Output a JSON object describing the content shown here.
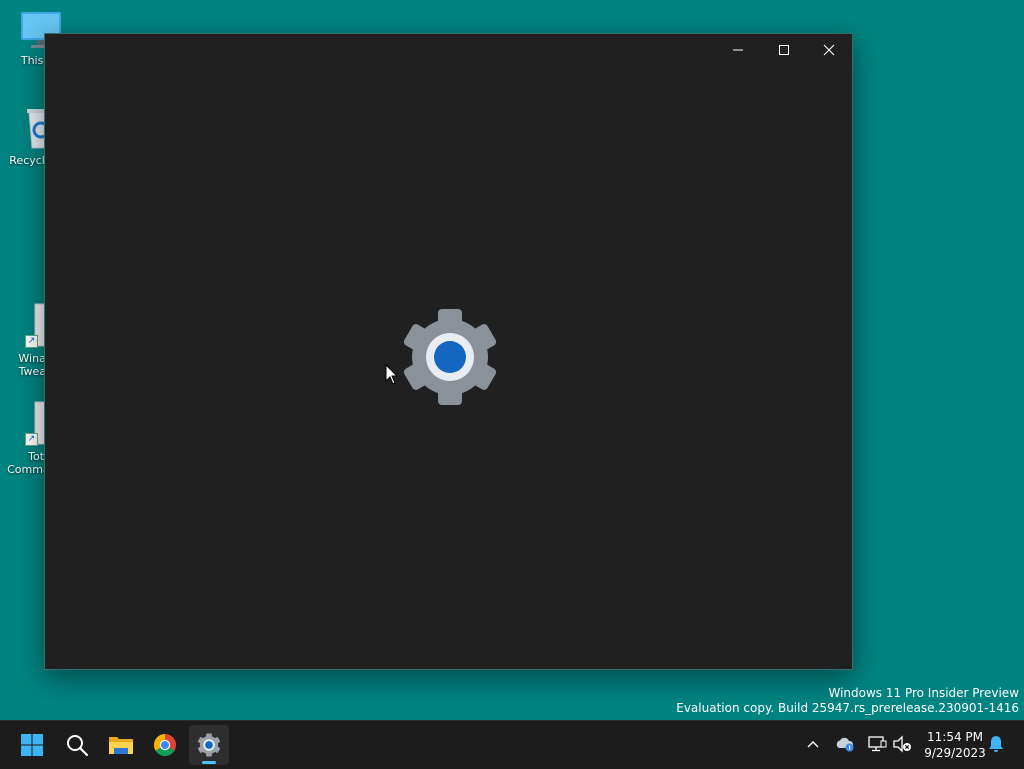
{
  "desktop": {
    "icons": [
      {
        "name": "this-pc",
        "label": "This PC"
      },
      {
        "name": "recycle-bin",
        "label": "Recycle Bin"
      },
      {
        "name": "winaero-tweaker",
        "label": "Winaero Tweaker"
      },
      {
        "name": "total-commander",
        "label": "Total Commander"
      }
    ]
  },
  "window": {
    "controls": {
      "minimize": "minimize",
      "maximize": "maximize",
      "close": "close"
    },
    "splash_icon": "settings-gear-icon"
  },
  "watermark": {
    "line1": "Windows 11 Pro Insider Preview",
    "line2": "Evaluation copy. Build 25947.rs_prerelease.230901-1416"
  },
  "taskbar": {
    "apps": [
      "start",
      "search",
      "file-explorer",
      "chrome",
      "settings"
    ],
    "active_app": "settings"
  },
  "tray": {
    "icons": [
      "chevron-up-icon",
      "onedrive-icon",
      "network-icon",
      "volume-muted-icon",
      "notification-bell-icon"
    ]
  },
  "clock": {
    "time": "11:54 PM",
    "date": "9/29/2023"
  },
  "colors": {
    "desktop": "#018481",
    "window": "#202020",
    "taskbar": "#1c1c1c",
    "accent": "#4cc2ff"
  }
}
